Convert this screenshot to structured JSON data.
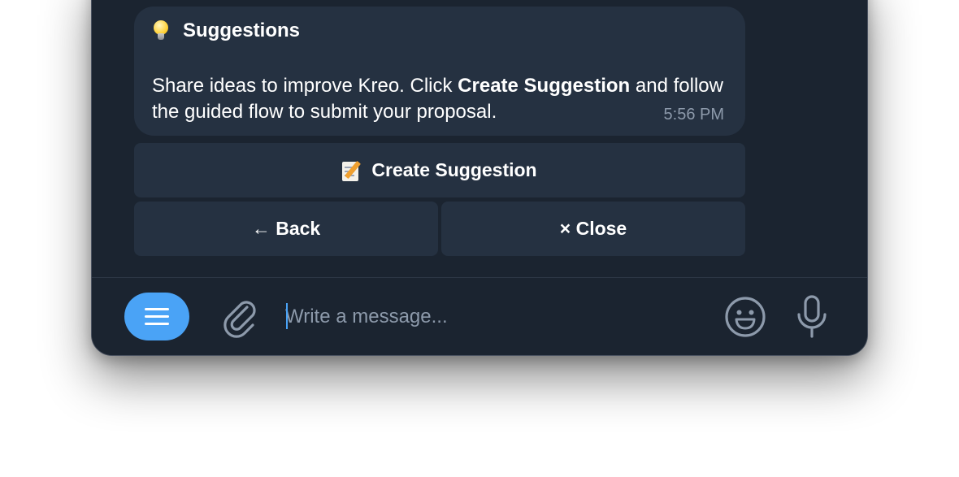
{
  "message": {
    "title": "Suggestions",
    "title_icon": "lightbulb-icon",
    "text_before": "Share ideas to improve Kreo. Click ",
    "text_bold": "Create Suggestion",
    "text_after": " and follow the guided flow to submit your proposal.",
    "time": "5:56 PM"
  },
  "keyboard": {
    "create_icon": "memo-icon",
    "create_label": "Create Suggestion",
    "back_label": "← Back",
    "close_label": "× Close"
  },
  "composer": {
    "placeholder": "Write a message...",
    "value": ""
  },
  "colors": {
    "background": "#1b2430",
    "bubble": "#253141",
    "accent": "#4aa3f6",
    "muted_text": "#8d9aab"
  }
}
